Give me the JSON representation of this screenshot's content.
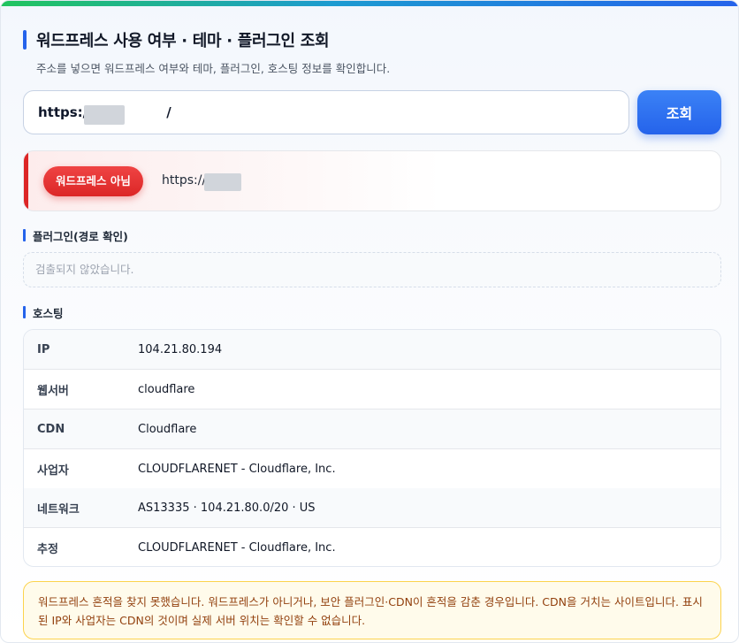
{
  "header": {
    "title": "워드프레스 사용 여부 · 테마 · 플러그인 조회",
    "subtitle": "주소를 넣으면 워드프레스 여부와 테마, 플러그인, 호스팅 정보를 확인합니다."
  },
  "search": {
    "value": "https://                /",
    "button_label": "조회"
  },
  "result": {
    "badge": "워드프레스 아님",
    "url": "https://            /"
  },
  "plugins": {
    "title": "플러그인(경로 확인)",
    "empty_text": "검출되지 않았습니다."
  },
  "hosting": {
    "title": "호스팅",
    "rows": [
      {
        "key": "IP",
        "value": "104.21.80.194"
      },
      {
        "key": "웹서버",
        "value": "cloudflare"
      },
      {
        "key": "CDN",
        "value": "Cloudflare"
      },
      {
        "key": "사업자",
        "value": "CLOUDFLARENET - Cloudflare, Inc."
      },
      {
        "key": "네트워크",
        "value": "AS13335 · 104.21.80.0/20 · US"
      },
      {
        "key": "추정",
        "value": "CLOUDFLARENET - Cloudflare, Inc."
      }
    ]
  },
  "notice": {
    "text": "워드프레스 흔적을 찾지 못했습니다. 워드프레스가 아니거나, 보안 플러그인·CDN이 흔적을 감춘 경우입니다. CDN을 거치는 사이트입니다. 표시된 IP와 사업자는 CDN의 것이며 실제 서버 위치는 확인할 수 없습니다."
  },
  "colors": {
    "accent": "#2563eb",
    "danger": "#dc2626",
    "warning_bg": "#fffbeb",
    "warning_text": "#92400e"
  }
}
